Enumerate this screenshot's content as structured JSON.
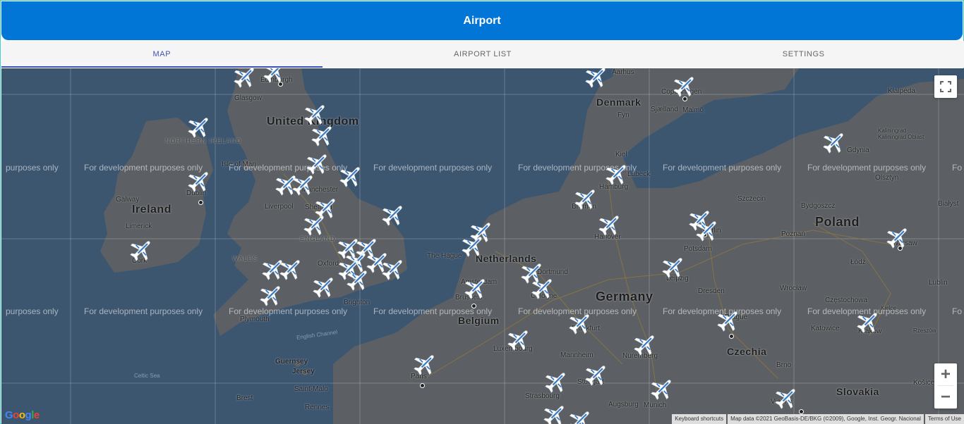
{
  "header": {
    "title": "Airport"
  },
  "tabs": [
    {
      "label": "MAP",
      "active": true
    },
    {
      "label": "AIRPORT LIST",
      "active": false
    },
    {
      "label": "SETTINGS",
      "active": false
    }
  ],
  "map": {
    "watermark_text": "For development purposes only",
    "watermark_partial_left": "purposes only",
    "watermark_partial_right": "Fo",
    "countries": [
      "United Kingdom",
      "Ireland",
      "Netherlands",
      "Germany",
      "Denmark",
      "Poland",
      "Belgium",
      "Czechia",
      "Slovakia",
      "Guernsey",
      "Jersey"
    ],
    "regions": [
      "NORTHERN IRELAND",
      "WALES",
      "ENGLAND"
    ],
    "cities": [
      "Edinburgh",
      "Glasgow",
      "Isle of Man",
      "Dublin",
      "Galway",
      "Limerick",
      "Liverpool",
      "Manchester",
      "Sheffield",
      "Oxford",
      "Brighton",
      "Plymouth",
      "Cork",
      "The Hague",
      "Brussels",
      "Paris",
      "Luxembourg",
      "Strasbourg",
      "Saint-Malo",
      "Brest",
      "Rennes",
      "Hamburg",
      "Bremen",
      "Hanover",
      "Dortmund",
      "Cologne",
      "Frankfurt",
      "Mannheim",
      "Stuttgart",
      "Nuremberg",
      "Augsburg",
      "Munich",
      "Leipzig",
      "Dresden",
      "Potsdam",
      "Berlin",
      "Copenhagen",
      "Malmö",
      "Aarhus",
      "Fyn",
      "Sjælland",
      "Kiel",
      "Lübeck",
      "Szczecin",
      "Poznań",
      "Bydgoszcz",
      "Gdynia",
      "Olsztyn",
      "Kaliningrad",
      "Kaliningrad Oblast",
      "Klaipėda",
      "Białyst",
      "Warsaw",
      "Łódź",
      "Lublin",
      "Wrocław",
      "Częstochowa",
      "Kielce",
      "Katowice",
      "Kraków",
      "Rzeszów",
      "Prague",
      "Brno",
      "Vienna",
      "Košice",
      "Amsterdam"
    ],
    "seas": [
      "English Channel",
      "Celtic Sea"
    ],
    "controls": {
      "fullscreen_icon": "fullscreen-icon",
      "zoom_in": "+",
      "zoom_out": "−"
    },
    "attribution": {
      "shortcuts": "Keyboard shortcuts",
      "data": "Map data ©2021 GeoBasis-DE/BKG (©2009), Google, Inst. Geogr. Nacional",
      "terms": "Terms of Use"
    },
    "logo": "Google",
    "marker_icon": "airplane-icon",
    "colors": {
      "sea": "#3d5670",
      "land": "#5b5f63",
      "header": "#0276d6",
      "active_tab": "#3f51b5",
      "plane_body": "#ffffff",
      "plane_accent": "#1565c0"
    }
  }
}
